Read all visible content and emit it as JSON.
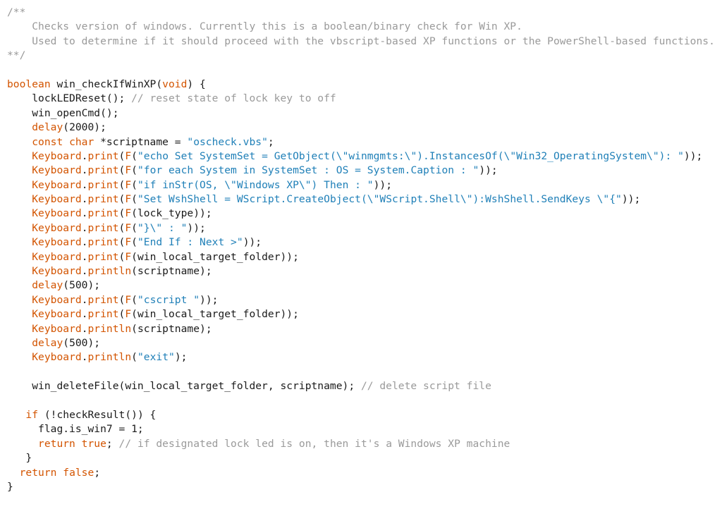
{
  "editor": {
    "language": "cpp",
    "background_color": "#ffffff",
    "theme_colors": {
      "plain": "#1a1a1a",
      "keyword": "#d35400",
      "function": "#d35400",
      "string": "#2080b8",
      "comment": "#9a9a9a",
      "punctuation": "#1a1a1a"
    }
  },
  "code": {
    "lines": [
      {
        "tokens": [
          {
            "t": "comment",
            "s": "/**"
          }
        ]
      },
      {
        "tokens": [
          {
            "t": "comment",
            "s": "    Checks version of windows. Currently this is a boolean/binary check for Win XP."
          }
        ]
      },
      {
        "tokens": [
          {
            "t": "comment",
            "s": "    Used to determine if it should proceed with the vbscript-based XP functions or the PowerShell-based functions."
          }
        ]
      },
      {
        "tokens": [
          {
            "t": "comment",
            "s": "**/"
          }
        ]
      },
      {
        "tokens": []
      },
      {
        "tokens": [
          {
            "t": "keyword",
            "s": "boolean"
          },
          {
            "t": "plain",
            "s": " win_checkIfWinXP("
          },
          {
            "t": "keyword",
            "s": "void"
          },
          {
            "t": "plain",
            "s": ") {"
          }
        ]
      },
      {
        "tokens": [
          {
            "t": "plain",
            "s": "    lockLEDReset(); "
          },
          {
            "t": "comment",
            "s": "// reset state of lock key to off"
          }
        ]
      },
      {
        "tokens": [
          {
            "t": "plain",
            "s": "    win_openCmd();"
          }
        ]
      },
      {
        "tokens": [
          {
            "t": "plain",
            "s": "    "
          },
          {
            "t": "function",
            "s": "delay"
          },
          {
            "t": "plain",
            "s": "(2000);"
          }
        ]
      },
      {
        "tokens": [
          {
            "t": "plain",
            "s": "    "
          },
          {
            "t": "keyword",
            "s": "const char"
          },
          {
            "t": "plain",
            "s": " *scriptname = "
          },
          {
            "t": "string",
            "s": "\"oscheck.vbs\""
          },
          {
            "t": "plain",
            "s": ";"
          }
        ]
      },
      {
        "tokens": [
          {
            "t": "plain",
            "s": "    "
          },
          {
            "t": "function",
            "s": "Keyboard"
          },
          {
            "t": "plain",
            "s": "."
          },
          {
            "t": "function",
            "s": "print"
          },
          {
            "t": "plain",
            "s": "("
          },
          {
            "t": "function",
            "s": "F"
          },
          {
            "t": "plain",
            "s": "("
          },
          {
            "t": "string",
            "s": "\"echo Set SystemSet = GetObject(\\\"winmgmts:\\\").InstancesOf(\\\"Win32_OperatingSystem\\\"): \""
          },
          {
            "t": "plain",
            "s": "));"
          }
        ]
      },
      {
        "tokens": [
          {
            "t": "plain",
            "s": "    "
          },
          {
            "t": "function",
            "s": "Keyboard"
          },
          {
            "t": "plain",
            "s": "."
          },
          {
            "t": "function",
            "s": "print"
          },
          {
            "t": "plain",
            "s": "("
          },
          {
            "t": "function",
            "s": "F"
          },
          {
            "t": "plain",
            "s": "("
          },
          {
            "t": "string",
            "s": "\"for each System in SystemSet : OS = System.Caption : \""
          },
          {
            "t": "plain",
            "s": "));"
          }
        ]
      },
      {
        "tokens": [
          {
            "t": "plain",
            "s": "    "
          },
          {
            "t": "function",
            "s": "Keyboard"
          },
          {
            "t": "plain",
            "s": "."
          },
          {
            "t": "function",
            "s": "print"
          },
          {
            "t": "plain",
            "s": "("
          },
          {
            "t": "function",
            "s": "F"
          },
          {
            "t": "plain",
            "s": "("
          },
          {
            "t": "string",
            "s": "\"if inStr(OS, \\\"Windows XP\\\") Then : \""
          },
          {
            "t": "plain",
            "s": "));"
          }
        ]
      },
      {
        "tokens": [
          {
            "t": "plain",
            "s": "    "
          },
          {
            "t": "function",
            "s": "Keyboard"
          },
          {
            "t": "plain",
            "s": "."
          },
          {
            "t": "function",
            "s": "print"
          },
          {
            "t": "plain",
            "s": "("
          },
          {
            "t": "function",
            "s": "F"
          },
          {
            "t": "plain",
            "s": "("
          },
          {
            "t": "string",
            "s": "\"Set WshShell = WScript.CreateObject(\\\"WScript.Shell\\\"):WshShell.SendKeys \\\"{\""
          },
          {
            "t": "plain",
            "s": "));"
          }
        ]
      },
      {
        "tokens": [
          {
            "t": "plain",
            "s": "    "
          },
          {
            "t": "function",
            "s": "Keyboard"
          },
          {
            "t": "plain",
            "s": "."
          },
          {
            "t": "function",
            "s": "print"
          },
          {
            "t": "plain",
            "s": "("
          },
          {
            "t": "function",
            "s": "F"
          },
          {
            "t": "plain",
            "s": "(lock_type));"
          }
        ]
      },
      {
        "tokens": [
          {
            "t": "plain",
            "s": "    "
          },
          {
            "t": "function",
            "s": "Keyboard"
          },
          {
            "t": "plain",
            "s": "."
          },
          {
            "t": "function",
            "s": "print"
          },
          {
            "t": "plain",
            "s": "("
          },
          {
            "t": "function",
            "s": "F"
          },
          {
            "t": "plain",
            "s": "("
          },
          {
            "t": "string",
            "s": "\"}\\\" : \""
          },
          {
            "t": "plain",
            "s": "));"
          }
        ]
      },
      {
        "tokens": [
          {
            "t": "plain",
            "s": "    "
          },
          {
            "t": "function",
            "s": "Keyboard"
          },
          {
            "t": "plain",
            "s": "."
          },
          {
            "t": "function",
            "s": "print"
          },
          {
            "t": "plain",
            "s": "("
          },
          {
            "t": "function",
            "s": "F"
          },
          {
            "t": "plain",
            "s": "("
          },
          {
            "t": "string",
            "s": "\"End If : Next >\""
          },
          {
            "t": "plain",
            "s": "));"
          }
        ]
      },
      {
        "tokens": [
          {
            "t": "plain",
            "s": "    "
          },
          {
            "t": "function",
            "s": "Keyboard"
          },
          {
            "t": "plain",
            "s": "."
          },
          {
            "t": "function",
            "s": "print"
          },
          {
            "t": "plain",
            "s": "("
          },
          {
            "t": "function",
            "s": "F"
          },
          {
            "t": "plain",
            "s": "(win_local_target_folder));"
          }
        ]
      },
      {
        "tokens": [
          {
            "t": "plain",
            "s": "    "
          },
          {
            "t": "function",
            "s": "Keyboard"
          },
          {
            "t": "plain",
            "s": "."
          },
          {
            "t": "function",
            "s": "println"
          },
          {
            "t": "plain",
            "s": "(scriptname);"
          }
        ]
      },
      {
        "tokens": [
          {
            "t": "plain",
            "s": "    "
          },
          {
            "t": "function",
            "s": "delay"
          },
          {
            "t": "plain",
            "s": "(500);"
          }
        ]
      },
      {
        "tokens": [
          {
            "t": "plain",
            "s": "    "
          },
          {
            "t": "function",
            "s": "Keyboard"
          },
          {
            "t": "plain",
            "s": "."
          },
          {
            "t": "function",
            "s": "print"
          },
          {
            "t": "plain",
            "s": "("
          },
          {
            "t": "function",
            "s": "F"
          },
          {
            "t": "plain",
            "s": "("
          },
          {
            "t": "string",
            "s": "\"cscript \""
          },
          {
            "t": "plain",
            "s": "));"
          }
        ]
      },
      {
        "tokens": [
          {
            "t": "plain",
            "s": "    "
          },
          {
            "t": "function",
            "s": "Keyboard"
          },
          {
            "t": "plain",
            "s": "."
          },
          {
            "t": "function",
            "s": "print"
          },
          {
            "t": "plain",
            "s": "("
          },
          {
            "t": "function",
            "s": "F"
          },
          {
            "t": "plain",
            "s": "(win_local_target_folder));"
          }
        ]
      },
      {
        "tokens": [
          {
            "t": "plain",
            "s": "    "
          },
          {
            "t": "function",
            "s": "Keyboard"
          },
          {
            "t": "plain",
            "s": "."
          },
          {
            "t": "function",
            "s": "println"
          },
          {
            "t": "plain",
            "s": "(scriptname);"
          }
        ]
      },
      {
        "tokens": [
          {
            "t": "plain",
            "s": "    "
          },
          {
            "t": "function",
            "s": "delay"
          },
          {
            "t": "plain",
            "s": "(500);"
          }
        ]
      },
      {
        "tokens": [
          {
            "t": "plain",
            "s": "    "
          },
          {
            "t": "function",
            "s": "Keyboard"
          },
          {
            "t": "plain",
            "s": "."
          },
          {
            "t": "function",
            "s": "println"
          },
          {
            "t": "plain",
            "s": "("
          },
          {
            "t": "string",
            "s": "\"exit\""
          },
          {
            "t": "plain",
            "s": ");"
          }
        ]
      },
      {
        "tokens": []
      },
      {
        "tokens": [
          {
            "t": "plain",
            "s": "    win_deleteFile(win_local_target_folder, scriptname); "
          },
          {
            "t": "comment",
            "s": "// delete script file"
          }
        ]
      },
      {
        "tokens": []
      },
      {
        "tokens": [
          {
            "t": "plain",
            "s": "   "
          },
          {
            "t": "keyword",
            "s": "if"
          },
          {
            "t": "plain",
            "s": " (!checkResult()) {"
          }
        ]
      },
      {
        "tokens": [
          {
            "t": "plain",
            "s": "     flag.is_win7 = 1;"
          }
        ]
      },
      {
        "tokens": [
          {
            "t": "plain",
            "s": "     "
          },
          {
            "t": "keyword",
            "s": "return true"
          },
          {
            "t": "plain",
            "s": "; "
          },
          {
            "t": "comment",
            "s": "// if designated lock led is on, then it's a Windows XP machine"
          }
        ]
      },
      {
        "tokens": [
          {
            "t": "plain",
            "s": "   }"
          }
        ]
      },
      {
        "tokens": [
          {
            "t": "plain",
            "s": "  "
          },
          {
            "t": "keyword",
            "s": "return false"
          },
          {
            "t": "plain",
            "s": ";"
          }
        ]
      },
      {
        "tokens": [
          {
            "t": "plain",
            "s": "}"
          }
        ]
      }
    ]
  }
}
